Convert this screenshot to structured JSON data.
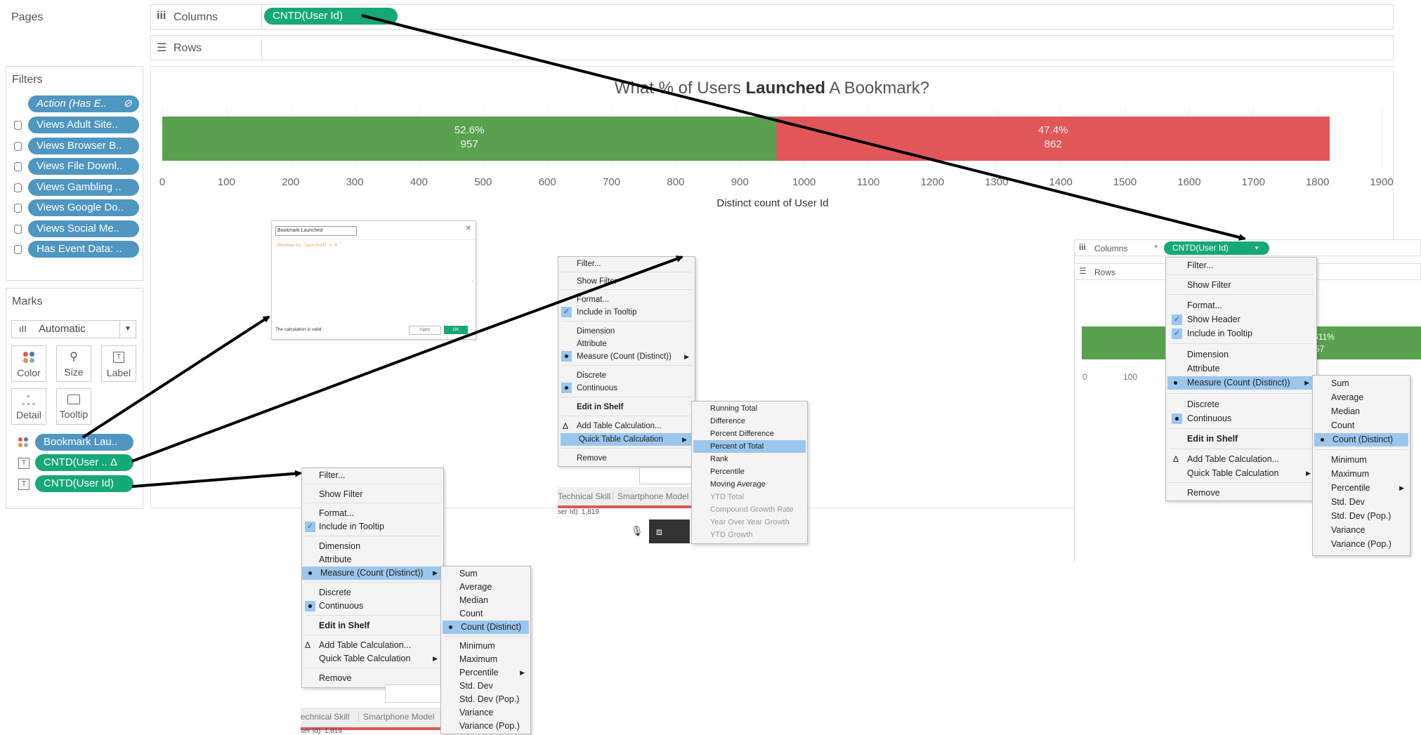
{
  "pages": {
    "title": "Pages"
  },
  "shelves": {
    "columns_label": "Columns",
    "rows_label": "Rows",
    "columns_pill": "CNTD(User Id)"
  },
  "filters": {
    "title": "Filters",
    "items": [
      "Action (Has E..",
      "Views Adult Site..",
      "Views Browser B..",
      "Views File Downl..",
      "Views Gambling ..",
      "Views Google Do..",
      "Views Social Me..",
      "Has Event Data: .."
    ]
  },
  "marks": {
    "title": "Marks",
    "type": "Automatic",
    "buttons": [
      "Color",
      "Size",
      "Label",
      "Detail",
      "Tooltip"
    ],
    "pills": [
      "Bookmark Lau..",
      "CNTD(User .. Δ",
      "CNTD(User Id)"
    ]
  },
  "chart_data": {
    "type": "bar",
    "title_pre": "What % of Users ",
    "title_bold": "Launched",
    "title_post": " A Bookmark?",
    "xlabel": "Distinct count of User Id",
    "xlim": [
      0,
      1900
    ],
    "ticks": [
      "0",
      "100",
      "200",
      "300",
      "400",
      "500",
      "600",
      "700",
      "800",
      "900",
      "1000",
      "1100",
      "1200",
      "1300",
      "1400",
      "1500",
      "1600",
      "1700",
      "1800",
      "1900"
    ],
    "segments": [
      {
        "value": 957,
        "percent": "52.6%",
        "count": "957",
        "color": "#59a14f"
      },
      {
        "value": 862,
        "percent": "47.4%",
        "count": "862",
        "color": "#e15759"
      }
    ]
  },
  "calc_dialog": {
    "name_value": "Bookmark Launched",
    "formula": "[Bookmarks launched] > 0",
    "status": "The calculation is valid.",
    "apply_label": "Apply",
    "ok_label": "OK"
  },
  "menu_a": {
    "items": [
      "Filter...",
      "Show Filter",
      "Format...",
      "Include in Tooltip",
      "Dimension",
      "Attribute",
      "Measure (Count (Distinct))",
      "Discrete",
      "Continuous",
      "Edit in Shelf",
      "Add Table Calculation...",
      "Quick Table Calculation",
      "Remove"
    ],
    "submenu": [
      "Sum",
      "Average",
      "Median",
      "Count",
      "Count (Distinct)",
      "Minimum",
      "Maximum",
      "Percentile",
      "Std. Dev",
      "Std. Dev (Pop.)",
      "Variance",
      "Variance (Pop.)"
    ],
    "footer_tabs": [
      "echnical Skill",
      "Smartphone Model"
    ],
    "footer_status": "ser Id): 1,819"
  },
  "menu_b": {
    "items": [
      "Filter...",
      "Show Filter",
      "Format...",
      "Include in Tooltip",
      "Dimension",
      "Attribute",
      "Measure (Count (Distinct))",
      "Discrete",
      "Continuous",
      "Edit in Shelf",
      "Add Table Calculation...",
      "Quick Table Calculation",
      "Remove"
    ],
    "submenu": [
      "Running Total",
      "Difference",
      "Percent Difference",
      "Percent of Total",
      "Rank",
      "Percentile",
      "Moving Average",
      "YTD Total",
      "Compound Growth Rate",
      "Year Over Year Growth",
      "YTD Growth"
    ],
    "footer_tabs": [
      "Technical Skill",
      "Smartphone Model"
    ],
    "footer_status": "ser Id): 1,819"
  },
  "menu_c": {
    "columns_label": "Columns",
    "rows_label": "Rows",
    "pill": "CNTD(User Id)",
    "items": [
      "Filter...",
      "Show Filter",
      "Format...",
      "Show Header",
      "Include in Tooltip",
      "Dimension",
      "Attribute",
      "Measure (Count (Distinct))",
      "Discrete",
      "Continuous",
      "Edit in Shelf",
      "Add Table Calculation...",
      "Quick Table Calculation",
      "Remove"
    ],
    "submenu": [
      "Sum",
      "Average",
      "Median",
      "Count",
      "Count (Distinct)",
      "Minimum",
      "Maximum",
      "Percentile",
      "Std. Dev",
      "Std. Dev (Pop.)",
      "Variance",
      "Variance (Pop.)"
    ],
    "bg_bar_label1": "611%",
    "bg_bar_label2": "57",
    "bg_ticks": [
      "0",
      "100"
    ]
  },
  "colors": {
    "accent_green": "#16a877",
    "pill_blue": "#4f96c1",
    "menu_highlight": "#9bc6ee"
  }
}
